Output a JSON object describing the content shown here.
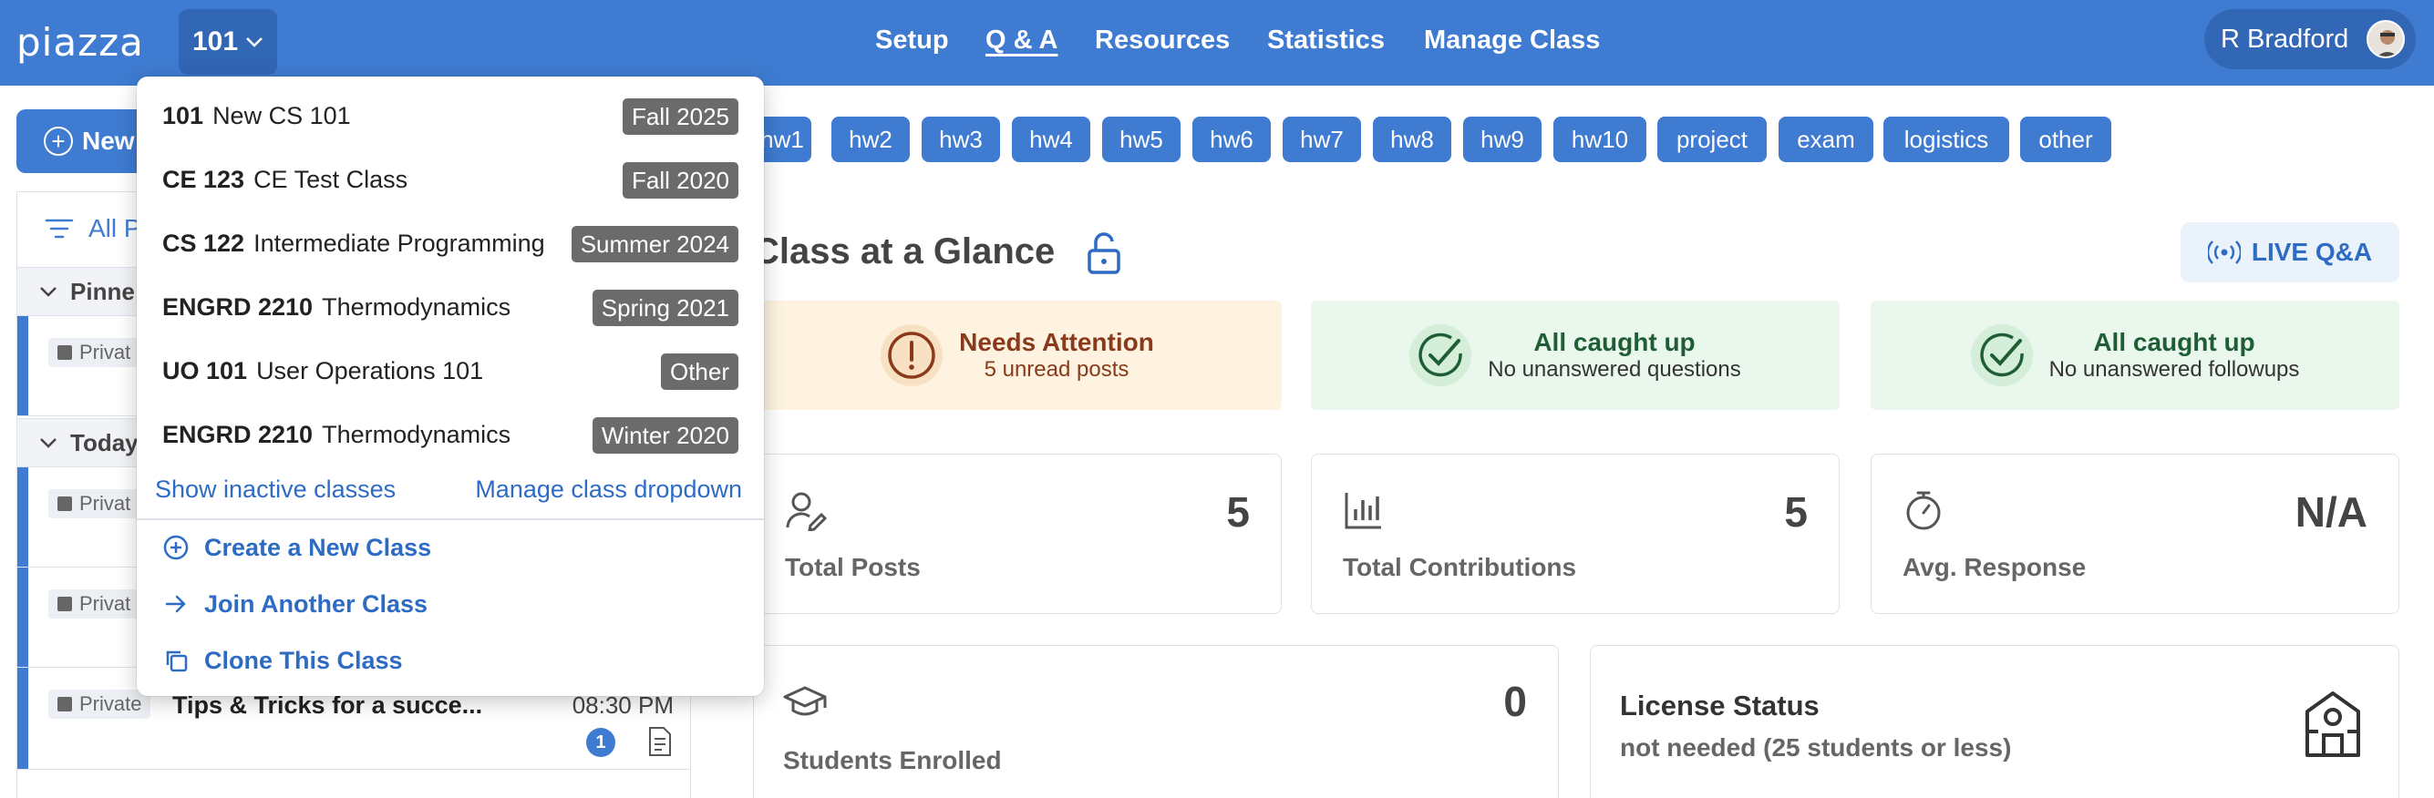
{
  "header": {
    "logo": "piazza",
    "current_class": "101",
    "nav": [
      "Setup",
      "Q & A",
      "Resources",
      "Statistics",
      "Manage Class"
    ],
    "active_nav": "Q & A",
    "user_name": "R Bradford"
  },
  "sidebar": {
    "new_post_label": "New",
    "filter_label": "All P",
    "sections": [
      "Pinne",
      "Today"
    ],
    "posts": [
      {
        "tag": "Privat",
        "title": "",
        "time": ""
      },
      {
        "tag": "Privat",
        "title": "",
        "time": ""
      },
      {
        "tag": "Privat",
        "title": "",
        "time": ""
      },
      {
        "tag": "Private",
        "title": "Tips & Tricks for a succe...",
        "time": "08:30 PM",
        "count": "1"
      }
    ]
  },
  "tags": [
    "hw1",
    "hw2",
    "hw3",
    "hw4",
    "hw5",
    "hw6",
    "hw7",
    "hw8",
    "hw9",
    "hw10",
    "project",
    "exam",
    "logistics",
    "other"
  ],
  "glance": {
    "title": "Class at a Glance",
    "live_label": "LIVE Q&A",
    "status_cards": [
      {
        "title": "Needs Attention",
        "subtitle": "5 unread posts"
      },
      {
        "title": "All caught up",
        "subtitle": "No unanswered questions"
      },
      {
        "title": "All caught up",
        "subtitle": "No unanswered followups"
      }
    ],
    "stats": [
      {
        "value": "5",
        "label": "Total Posts"
      },
      {
        "value": "5",
        "label": "Total Contributions"
      },
      {
        "value": "N/A",
        "label": "Avg. Response"
      }
    ],
    "enrolled": {
      "value": "0",
      "label": "Students Enrolled"
    },
    "license": {
      "title": "License Status",
      "subtitle": "not needed (25 students or less)"
    }
  },
  "dropdown": {
    "classes": [
      {
        "num": "101",
        "name": "New CS 101",
        "term": "Fall 2025"
      },
      {
        "num": "CE 123",
        "name": "CE Test Class",
        "term": "Fall 2020"
      },
      {
        "num": "CS 122",
        "name": "Intermediate Programming",
        "term": "Summer 2024"
      },
      {
        "num": "ENGRD 2210",
        "name": "Thermodynamics",
        "term": "Spring 2021"
      },
      {
        "num": "UO 101",
        "name": "User Operations 101",
        "term": "Other"
      },
      {
        "num": "ENGRD 2210",
        "name": "Thermodynamics",
        "term": "Winter 2020"
      }
    ],
    "show_inactive": "Show inactive classes",
    "manage_dropdown": "Manage class dropdown",
    "actions": [
      "Create a New Class",
      "Join Another Class",
      "Clone This Class"
    ]
  },
  "colors": {
    "brand_blue": "#3e7bd1",
    "attention_bg": "#fdf3e0",
    "ok_bg": "#eaf7ec",
    "term_badge": "#6b6b6b"
  }
}
